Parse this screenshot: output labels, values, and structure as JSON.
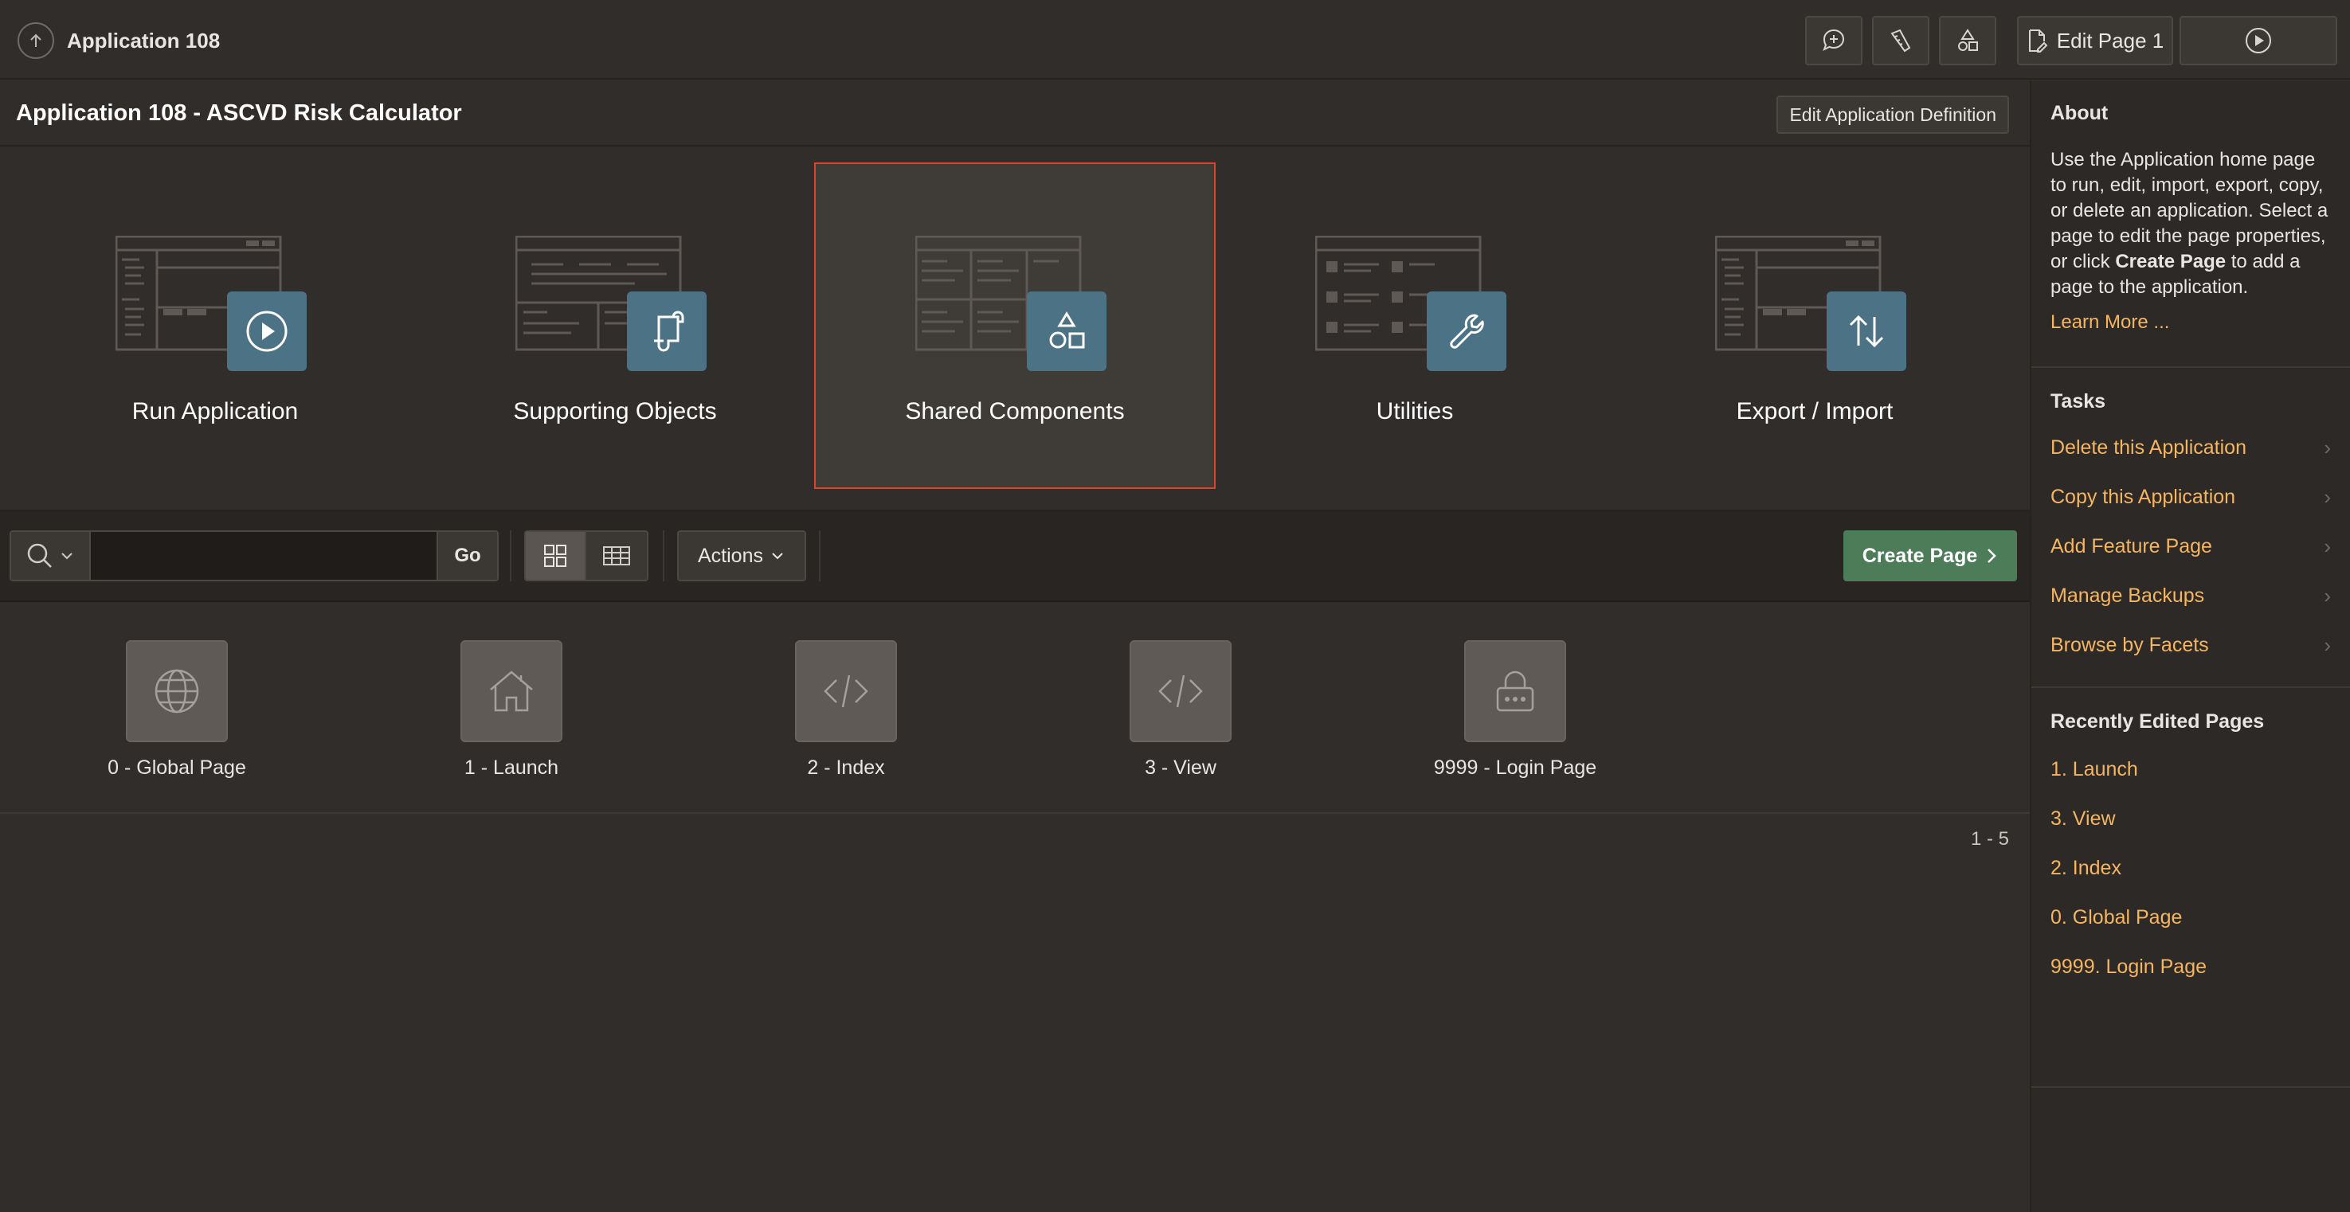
{
  "header": {
    "app_name": "Application 108",
    "edit_page_label": "Edit Page 1"
  },
  "titlebar": {
    "title": "Application 108 - ASCVD Risk Calculator",
    "edit_definition_label": "Edit Application Definition"
  },
  "hero": {
    "cards": [
      {
        "label": "Run Application",
        "icon": "play-icon"
      },
      {
        "label": "Supporting Objects",
        "icon": "scroll-icon"
      },
      {
        "label": "Shared Components",
        "icon": "shapes-icon",
        "selected": true
      },
      {
        "label": "Utilities",
        "icon": "wrench-icon"
      },
      {
        "label": "Export / Import",
        "icon": "arrows-updown-icon"
      }
    ]
  },
  "toolbar": {
    "search_value": "",
    "go_label": "Go",
    "actions_label": "Actions",
    "create_page_label": "Create Page"
  },
  "pages": {
    "items": [
      {
        "label": "0 - Global Page",
        "icon": "globe-icon"
      },
      {
        "label": "1 - Launch",
        "icon": "home-icon"
      },
      {
        "label": "2 - Index",
        "icon": "code-icon"
      },
      {
        "label": "3 - View",
        "icon": "code-icon"
      },
      {
        "label": "9999 - Login Page",
        "icon": "lock-icon"
      }
    ],
    "pagination": "1 - 5"
  },
  "sidebar": {
    "about": {
      "heading": "About",
      "text_part1": "Use the Application home page to run, edit, import, export, copy, or delete an application. Select a page to edit the page properties, or click ",
      "text_bold": "Create Page",
      "text_part2": " to add a page to the application.",
      "learn_more": "Learn More ..."
    },
    "tasks": {
      "heading": "Tasks",
      "items": [
        {
          "label": "Delete this Application"
        },
        {
          "label": "Copy this Application"
        },
        {
          "label": "Add Feature Page"
        },
        {
          "label": "Manage Backups"
        },
        {
          "label": "Browse by Facets"
        }
      ]
    },
    "recent": {
      "heading": "Recently Edited Pages",
      "items": [
        {
          "label": "1. Launch"
        },
        {
          "label": "3. View"
        },
        {
          "label": "2. Index"
        },
        {
          "label": "0. Global Page"
        },
        {
          "label": "9999. Login Page"
        }
      ]
    }
  },
  "colors": {
    "background": "#312d2a",
    "link": "#f6b55f",
    "accent_badge": "#4c7285",
    "create_button": "#4d7c58",
    "selected_border": "#d9462c"
  }
}
